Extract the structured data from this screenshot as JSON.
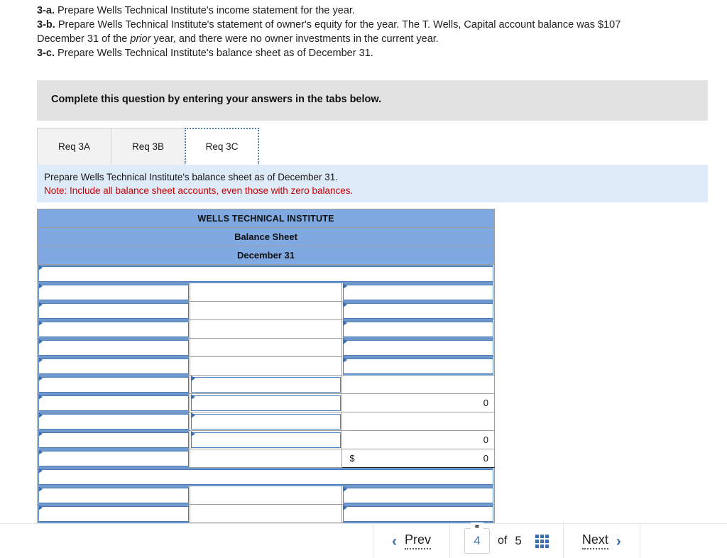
{
  "prompt": {
    "line_a_label": "3-a.",
    "line_a_text": "Prepare Wells Technical Institute's income statement for the year.",
    "line_b_label": "3-b.",
    "line_b_text_1": "Prepare Wells Technical Institute's statement of owner's equity for the year. The T. Wells, Capital account balance was $107",
    "line_b_text_2": "December 31 of the",
    "line_b_italic": "prior",
    "line_b_text_3": "year, and there were no owner investments in the current year.",
    "line_c_label": "3-c.",
    "line_c_text": "Prepare Wells Technical Institute's balance sheet as of December 31."
  },
  "banner": {
    "text": "Complete this question by entering your answers in the tabs below."
  },
  "tabs": [
    {
      "label": "Req 3A",
      "active": false
    },
    {
      "label": "Req 3B",
      "active": false
    },
    {
      "label": "Req 3C",
      "active": true
    }
  ],
  "requirement": {
    "instruction": "Prepare Wells Technical Institute's balance sheet as of December 31.",
    "note": "Note: Include all balance sheet accounts, even those with zero balances."
  },
  "sheet": {
    "title_company": "WELLS TECHNICAL INSTITUTE",
    "title_statement": "Balance Sheet",
    "title_date": "December 31",
    "rows": [
      {
        "type": "full-input",
        "label": "",
        "mid": "",
        "amount": ""
      },
      {
        "type": "input-blank-input",
        "label": "",
        "mid": "",
        "amount": ""
      },
      {
        "type": "input-blank-input",
        "label": "",
        "mid": "",
        "amount": ""
      },
      {
        "type": "input-blank-input",
        "label": "",
        "mid": "",
        "amount": ""
      },
      {
        "type": "input-blank-input",
        "label": "",
        "mid": "",
        "amount": ""
      },
      {
        "type": "input-blank-input",
        "label": "",
        "mid": "",
        "amount": ""
      },
      {
        "type": "input-input-value",
        "label": "",
        "mid": "",
        "amount": ""
      },
      {
        "type": "input-input-value",
        "label": "",
        "mid": "",
        "amount": "0"
      },
      {
        "type": "input-input-value",
        "label": "",
        "mid": "",
        "amount": "",
        "rule": "mid-top"
      },
      {
        "type": "input-input-value",
        "label": "",
        "mid": "",
        "amount": "0"
      },
      {
        "type": "input-blank-total",
        "label": "",
        "mid": "",
        "dollar": "$",
        "amount": "0"
      },
      {
        "type": "full-input",
        "label": "",
        "mid": "",
        "amount": ""
      },
      {
        "type": "input-blank-input",
        "label": "",
        "mid": "",
        "amount": ""
      },
      {
        "type": "input-blank-input",
        "label": "",
        "mid": "",
        "amount": ""
      }
    ]
  },
  "footer": {
    "prev_label": "Prev",
    "next_label": "Next",
    "current_page": "4",
    "of_label": "of",
    "total_pages": "5",
    "link_icon": "⚭",
    "prev_chevron": "‹",
    "next_chevron": "›"
  }
}
